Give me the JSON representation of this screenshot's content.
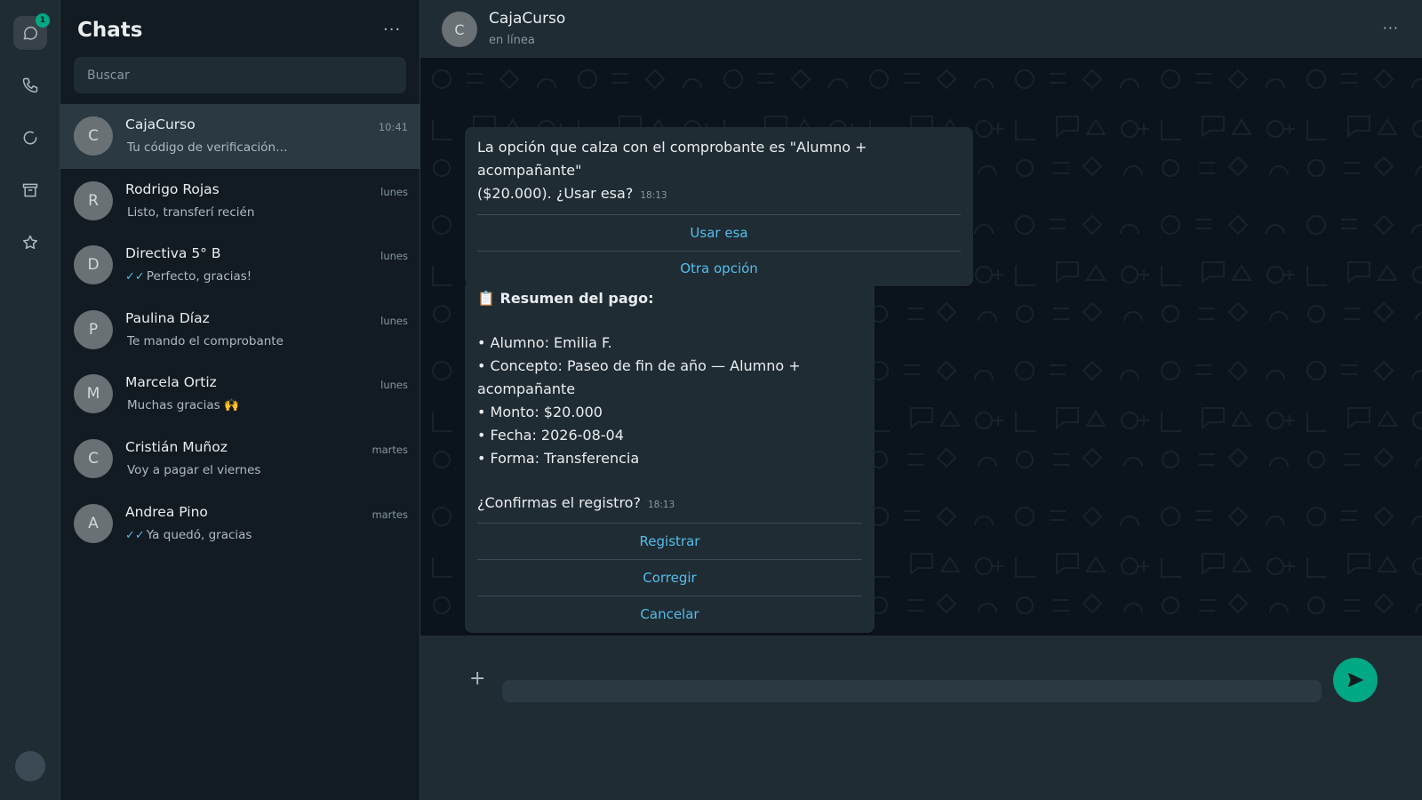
{
  "rail": {
    "unread_badge": "1",
    "items": [
      {
        "name": "chats-icon"
      },
      {
        "name": "phone-icon"
      },
      {
        "name": "status-icon"
      },
      {
        "name": "archive-icon"
      },
      {
        "name": "star-icon"
      }
    ]
  },
  "list": {
    "title": "Chats",
    "menu": "···",
    "search_placeholder": "Buscar",
    "chats": [
      {
        "initial": "C",
        "name": "CajaCurso",
        "time": "10:41",
        "ticks": "",
        "preview": "Tu código de verificación…",
        "selected": true
      },
      {
        "initial": "R",
        "name": "Rodrigo Rojas",
        "time": "lunes",
        "ticks": "",
        "preview": "Listo, transferí recién"
      },
      {
        "initial": "D",
        "name": "Directiva 5° B",
        "time": "lunes",
        "ticks": "✓✓",
        "preview": "Perfecto, gracias!"
      },
      {
        "initial": "P",
        "name": "Paulina Díaz",
        "time": "lunes",
        "ticks": "",
        "preview": "Te mando el comprobante"
      },
      {
        "initial": "M",
        "name": "Marcela Ortiz",
        "time": "lunes",
        "ticks": "",
        "preview": "Muchas gracias 🙌"
      },
      {
        "initial": "C",
        "name": "Cristián Muñoz",
        "time": "martes",
        "ticks": "",
        "preview": "Voy a pagar el viernes"
      },
      {
        "initial": "A",
        "name": "Andrea Pino",
        "time": "martes",
        "ticks": "✓✓",
        "preview": "Ya quedó, gracias"
      }
    ]
  },
  "conversation": {
    "initial": "C",
    "name": "CajaCurso",
    "status": "en línea",
    "menu": "···",
    "messages": [
      {
        "text_line1": "La opción que calza con el comprobante es \"Alumno + acompañante\"",
        "text_line2": "($20.000). ¿Usar esa?",
        "time": "18:13",
        "buttons": [
          "Usar esa",
          "Otra opción"
        ]
      },
      {
        "heading_icon": "📋",
        "heading": "Resumen del pago:",
        "lines": [
          "• Alumno: Emilia F.",
          "• Concepto: Paseo de fin de año — Alumno + acompañante",
          "• Monto: $20.000",
          "• Fecha: 2026-08-04",
          "• Forma: Transferencia"
        ],
        "question": "¿Confirmas el registro?",
        "time": "18:13",
        "buttons": [
          "Registrar",
          "Corregir",
          "Cancelar"
        ]
      }
    ]
  },
  "composer": {
    "plus": "+",
    "placeholder": ""
  },
  "colors": {
    "accent": "#00a884",
    "link": "#53bdeb",
    "panel": "#202c33",
    "background": "#0b141a"
  }
}
